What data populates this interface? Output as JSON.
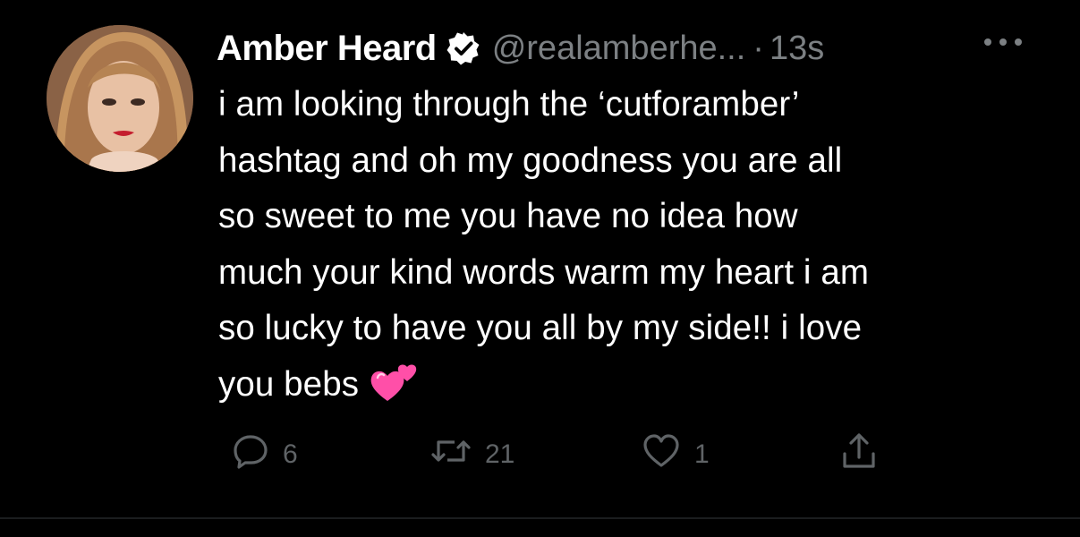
{
  "tweet": {
    "author_name": "Amber Heard",
    "handle": "@realamberhe...",
    "separator": "·",
    "time": "13s",
    "verified": true,
    "text": "i am looking through the ‘cutforamber’ hashtag and oh my goodness you are all so sweet to me you have no idea how much your kind words warm my heart i am so lucky to have you all by my side!! i love you bebs",
    "text_lines": [
      "i am looking through the ‘cutforamber’",
      "hashtag and oh my goodness you are all",
      "so sweet to me you have no idea how",
      "much your kind words warm my heart i am",
      "so lucky to have you all by my side!! i love",
      "you bebs"
    ],
    "emoji": "two-hearts-icon"
  },
  "actions": {
    "reply_count": "6",
    "retweet_count": "21",
    "like_count": "1"
  },
  "icons": {
    "avatar": "profile-photo",
    "verified": "verified-badge-icon",
    "more": "more-options-icon",
    "reply": "reply-icon",
    "retweet": "retweet-icon",
    "like": "heart-icon",
    "share": "share-icon"
  },
  "colors": {
    "background": "#000000",
    "primary_text": "#ffffff",
    "secondary_text": "#7c8083",
    "action_icons": "#5f6366",
    "emoji_pink": "#ff4fa8"
  }
}
